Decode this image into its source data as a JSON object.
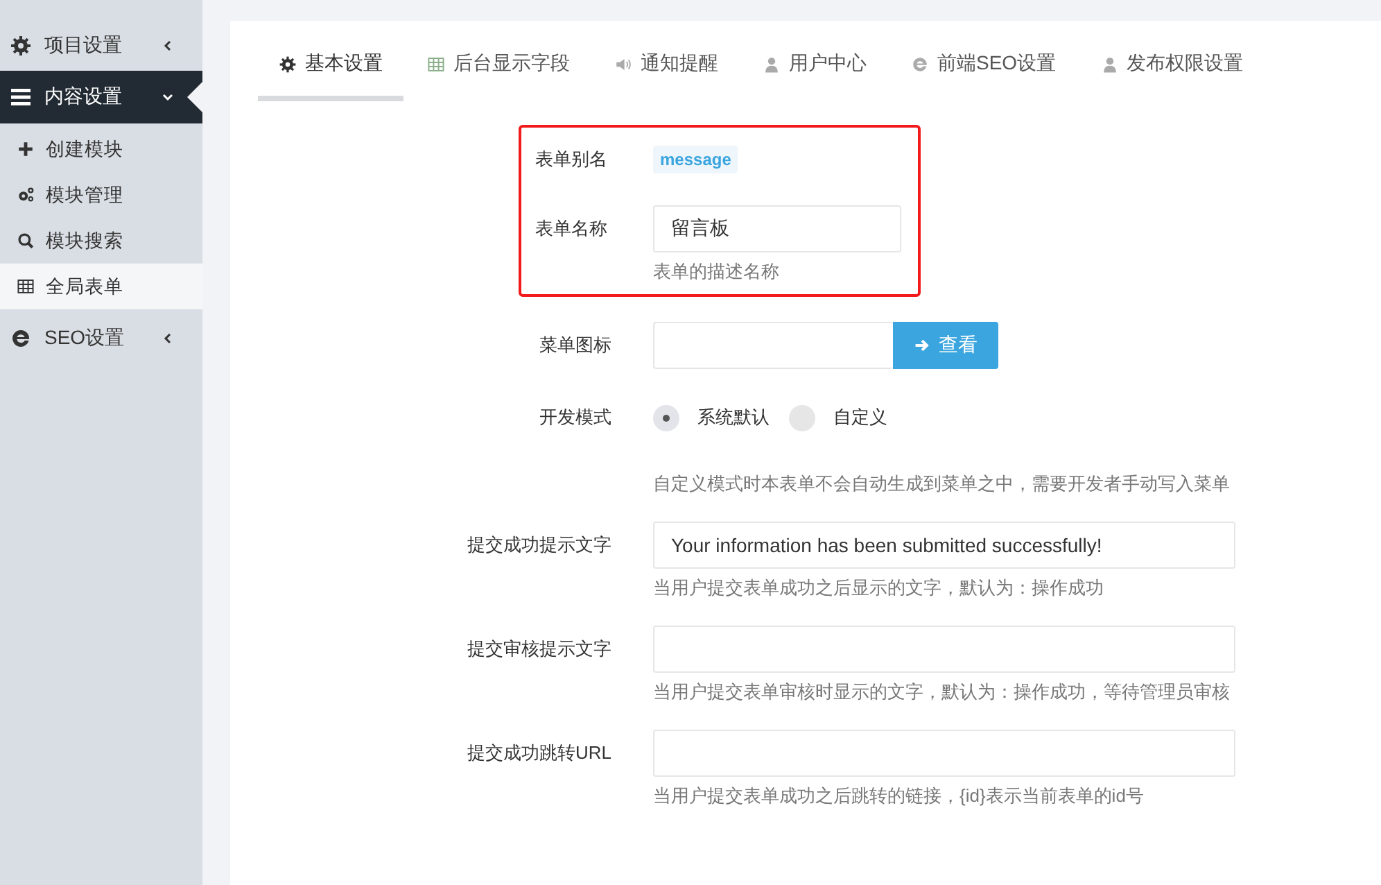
{
  "sidebar": {
    "items": [
      {
        "label": "项目设置",
        "expanded": false,
        "selected": false
      },
      {
        "label": "内容设置",
        "expanded": true,
        "selected": true,
        "children": [
          {
            "label": "创建模块",
            "selected": false
          },
          {
            "label": "模块管理",
            "selected": false
          },
          {
            "label": "模块搜索",
            "selected": false
          },
          {
            "label": "全局表单",
            "selected": true
          }
        ]
      },
      {
        "label": "SEO设置",
        "expanded": false,
        "selected": false
      }
    ]
  },
  "tabs": [
    {
      "label": "基本设置",
      "selected": true
    },
    {
      "label": "后台显示字段",
      "selected": false
    },
    {
      "label": "通知提醒",
      "selected": false
    },
    {
      "label": "用户中心",
      "selected": false
    },
    {
      "label": "前端SEO设置",
      "selected": false
    },
    {
      "label": "发布权限设置",
      "selected": false
    }
  ],
  "highlighted_fields": [
    {
      "kind": "tag",
      "label": "表单别名",
      "value": "message"
    },
    {
      "kind": "input",
      "label": "表单名称",
      "value": "留言板",
      "help": "表单的描述名称"
    }
  ],
  "fields": [
    {
      "kind": "input-button",
      "label": "菜单图标",
      "button": "查看"
    },
    {
      "kind": "radio",
      "label": "开发模式",
      "options": [
        {
          "label": "系统默认",
          "selected": true
        },
        {
          "label": "自定义",
          "selected": false
        }
      ],
      "help": "自定义模式时本表单不会自动生成到菜单之中，需要开发者手动写入菜单"
    },
    {
      "kind": "input",
      "label": "提交成功提示文字",
      "value": "Your information has been submitted successfully!",
      "help": "当用户提交表单成功之后显示的文字，默认为：操作成功"
    },
    {
      "kind": "input",
      "label": "提交审核提示文字",
      "help": "当用户提交表单审核时显示的文字，默认为：操作成功，等待管理员审核"
    },
    {
      "kind": "input",
      "label": "提交成功跳转URL",
      "help": "当用户提交表单成功之后跳转的链接，{id}表示当前表单的id号"
    }
  ]
}
